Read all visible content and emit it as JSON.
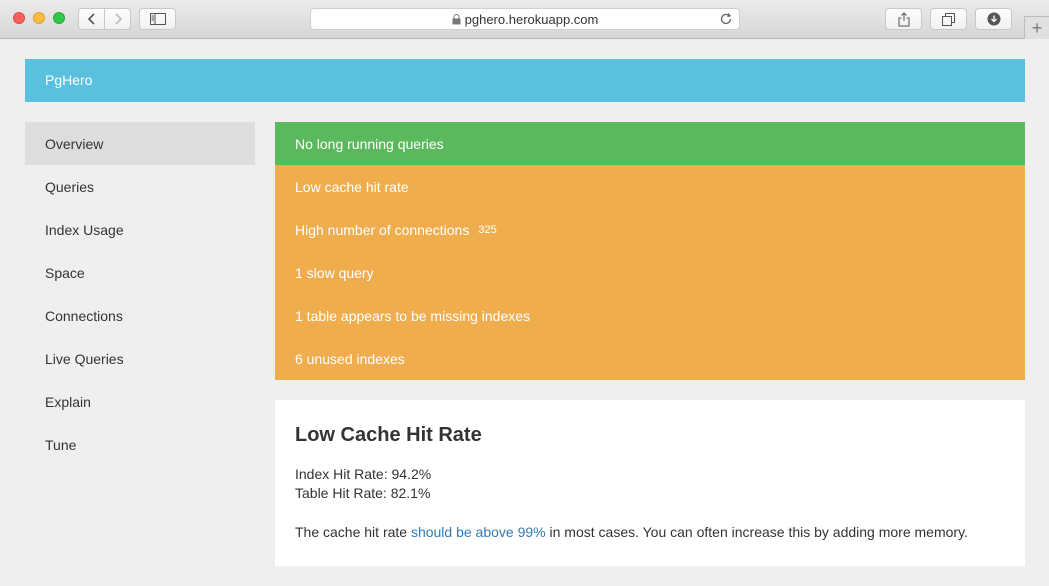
{
  "browser": {
    "url": "pghero.herokuapp.com"
  },
  "navbar": {
    "brand": "PgHero"
  },
  "sidebar": {
    "items": [
      {
        "label": "Overview",
        "active": true
      },
      {
        "label": "Queries"
      },
      {
        "label": "Index Usage"
      },
      {
        "label": "Space"
      },
      {
        "label": "Connections"
      },
      {
        "label": "Live Queries"
      },
      {
        "label": "Explain"
      },
      {
        "label": "Tune"
      }
    ]
  },
  "alerts": [
    {
      "text": "No long running queries",
      "status": "green"
    },
    {
      "text": "Low cache hit rate",
      "status": "orange"
    },
    {
      "text": "High number of connections",
      "badge": "325",
      "status": "orange"
    },
    {
      "text": "1 slow query",
      "status": "orange"
    },
    {
      "text": "1 table appears to be missing indexes",
      "status": "orange"
    },
    {
      "text": "6 unused indexes",
      "status": "orange"
    }
  ],
  "panel": {
    "title": "Low Cache Hit Rate",
    "index_hit_rate": "Index Hit Rate: 94.2%",
    "table_hit_rate": "Table Hit Rate: 82.1%",
    "body_prefix": "The cache hit rate ",
    "body_link": "should be above 99%",
    "body_suffix": " in most cases. You can often increase this by adding more memory."
  },
  "colors": {
    "navbar": "#5bc0de",
    "success": "#5cb85c",
    "warning": "#f0ad4e",
    "link": "#337ab7"
  }
}
